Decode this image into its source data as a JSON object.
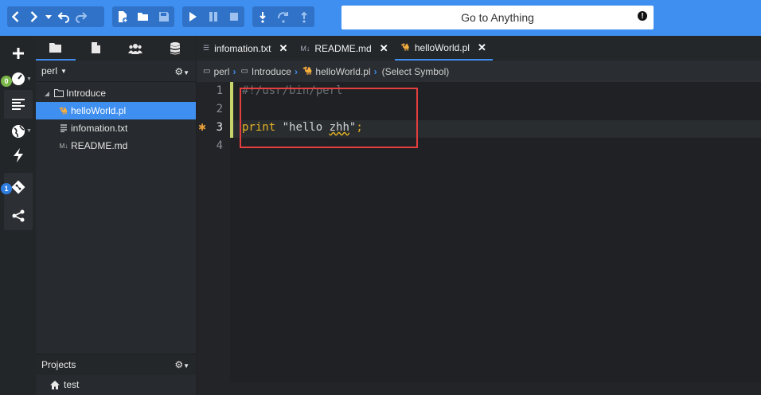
{
  "toolbar": {
    "groups": [
      [
        "back",
        "forward",
        "history-dropdown",
        "undo",
        "redo"
      ],
      [
        "new-file",
        "open-folder",
        "save"
      ],
      [
        "run",
        "pause",
        "stop"
      ],
      [
        "step-over",
        "step-in",
        "step-out"
      ]
    ],
    "goto_label": "Go to Anything",
    "goto_alert": "!"
  },
  "rail": {
    "badge_green": "0",
    "badge_blue": "1",
    "badge_green_color": "#7ab648",
    "badge_blue_color": "#2f7de1"
  },
  "side": {
    "project_selector": "perl",
    "tree": [
      {
        "label": "Introduce",
        "type": "folder"
      },
      {
        "label": "helloWorld.pl",
        "type": "perl",
        "selected": true
      },
      {
        "label": "infomation.txt",
        "type": "text"
      },
      {
        "label": "README.md",
        "type": "markdown"
      }
    ],
    "projects_label": "Projects",
    "project_item": "test"
  },
  "editor": {
    "tabs": [
      {
        "label": "infomation.txt",
        "icon": "text-icon",
        "active": false
      },
      {
        "label": "README.md",
        "icon": "markdown-icon",
        "active": false
      },
      {
        "label": "helloWorld.pl",
        "icon": "perl-icon",
        "active": true
      }
    ],
    "breadcrumb": {
      "root": "perl",
      "folder": "Introduce",
      "file": "helloWorld.pl",
      "symbol": "(Select Symbol)"
    },
    "line_numbers": [
      "1",
      "2",
      "3",
      "4"
    ],
    "code": {
      "line1": "#!/usr/bin/perl",
      "line3_keyword": "print",
      "line3_string_open": " \"hello ",
      "line3_string_word": "zhh",
      "line3_string_close": "\"",
      "line3_end": ";"
    }
  },
  "colors": {
    "accent": "#3f8ff0",
    "keyword": "#e6b422",
    "string": "#d4d4d4",
    "comment": "#6a6f75",
    "highlight_box": "#e53e3e"
  }
}
